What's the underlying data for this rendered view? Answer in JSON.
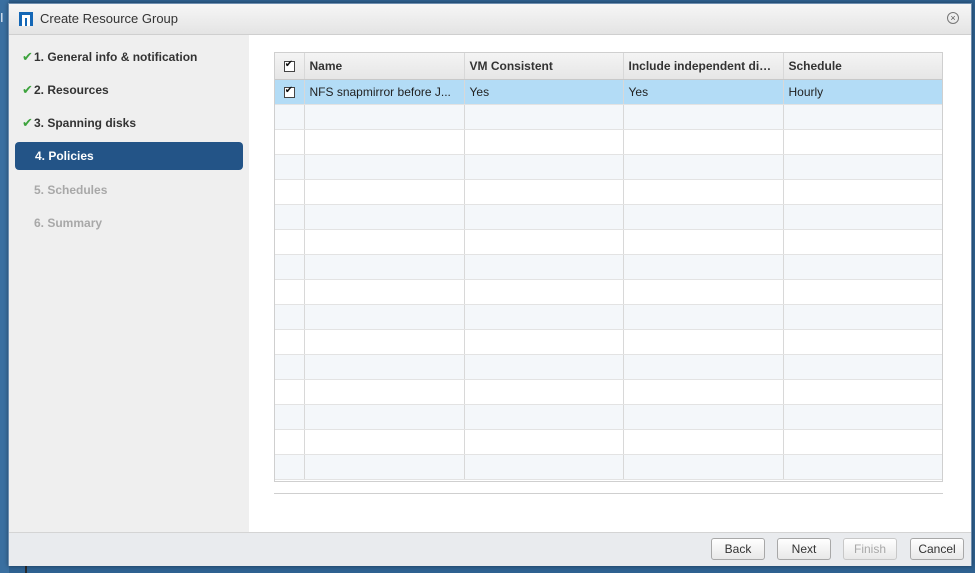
{
  "background": {
    "edge_text": "I"
  },
  "dialog": {
    "title": "Create Resource Group",
    "close_glyph": "×"
  },
  "wizard_steps": [
    {
      "label": "1. General info & notification",
      "state": "done"
    },
    {
      "label": "2. Resources",
      "state": "done"
    },
    {
      "label": "3. Spanning disks",
      "state": "done"
    },
    {
      "label": "4. Policies",
      "state": "active"
    },
    {
      "label": "5. Schedules",
      "state": "disabled"
    },
    {
      "label": "6. Summary",
      "state": "disabled"
    }
  ],
  "check_glyph": "✔",
  "policies_table": {
    "header_checkbox_checked": true,
    "columns": [
      "Name",
      "VM Consistent",
      "Include independent disks",
      "Schedule"
    ],
    "rows": [
      {
        "checked": true,
        "cells": [
          "NFS snapmirror before J...",
          "Yes",
          "Yes",
          "Hourly"
        ]
      }
    ],
    "empty_rows": 15
  },
  "footer": {
    "back_label": "Back",
    "next_label": "Next",
    "finish_label": "Finish",
    "cancel_label": "Cancel"
  },
  "colors": {
    "accent": "#235487",
    "selected_row": "#b3dcf6",
    "check_green": "#3da33d",
    "app_icon": "#1467b6"
  }
}
